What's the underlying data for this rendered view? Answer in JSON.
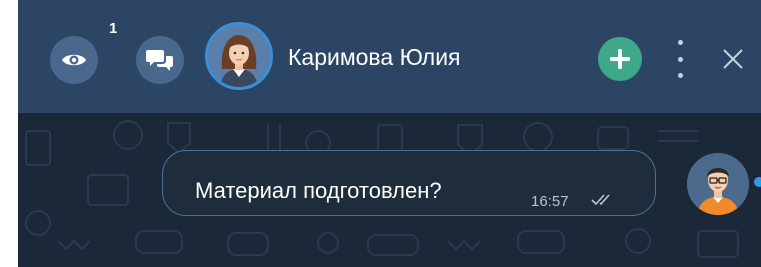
{
  "header": {
    "watchers_count": "1",
    "contact_name": "Каримова Юлия"
  },
  "message": {
    "text": "Материал подготовлен?",
    "time": "16:57"
  },
  "icons": {
    "watch": "eye-icon",
    "chats": "chat-bubbles-icon",
    "add": "plus-icon",
    "more": "more-vertical-icon",
    "close": "close-icon",
    "status": "double-check-icon"
  },
  "colors": {
    "header_bg": "#2d4564",
    "chat_bg": "#1b2838",
    "button_bg": "#4a678e",
    "add_button": "#3fa889",
    "avatar_ring": "#3a8fd6",
    "bubble_border": "#4c7196"
  }
}
